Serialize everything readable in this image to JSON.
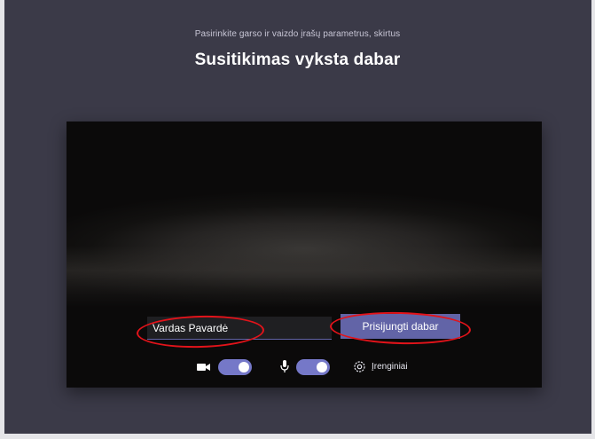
{
  "header": {
    "subtitle": "Pasirinkite garso ir vaizdo įrašų parametrus, skirtus",
    "title": "Susitikimas vyksta dabar"
  },
  "join_form": {
    "name_value": "Vardas Pavardė",
    "join_label": "Prisijungti dabar"
  },
  "controls": {
    "camera": {
      "icon": "video-camera-icon",
      "on": true
    },
    "microphone": {
      "icon": "microphone-icon",
      "on": true
    },
    "devices": {
      "icon": "gear-icon",
      "label": "Įrenginiai"
    }
  },
  "colors": {
    "background": "#3b3a48",
    "accent": "#6264a7",
    "toggle_on": "#7578c8",
    "annotation": "#e3131a"
  }
}
